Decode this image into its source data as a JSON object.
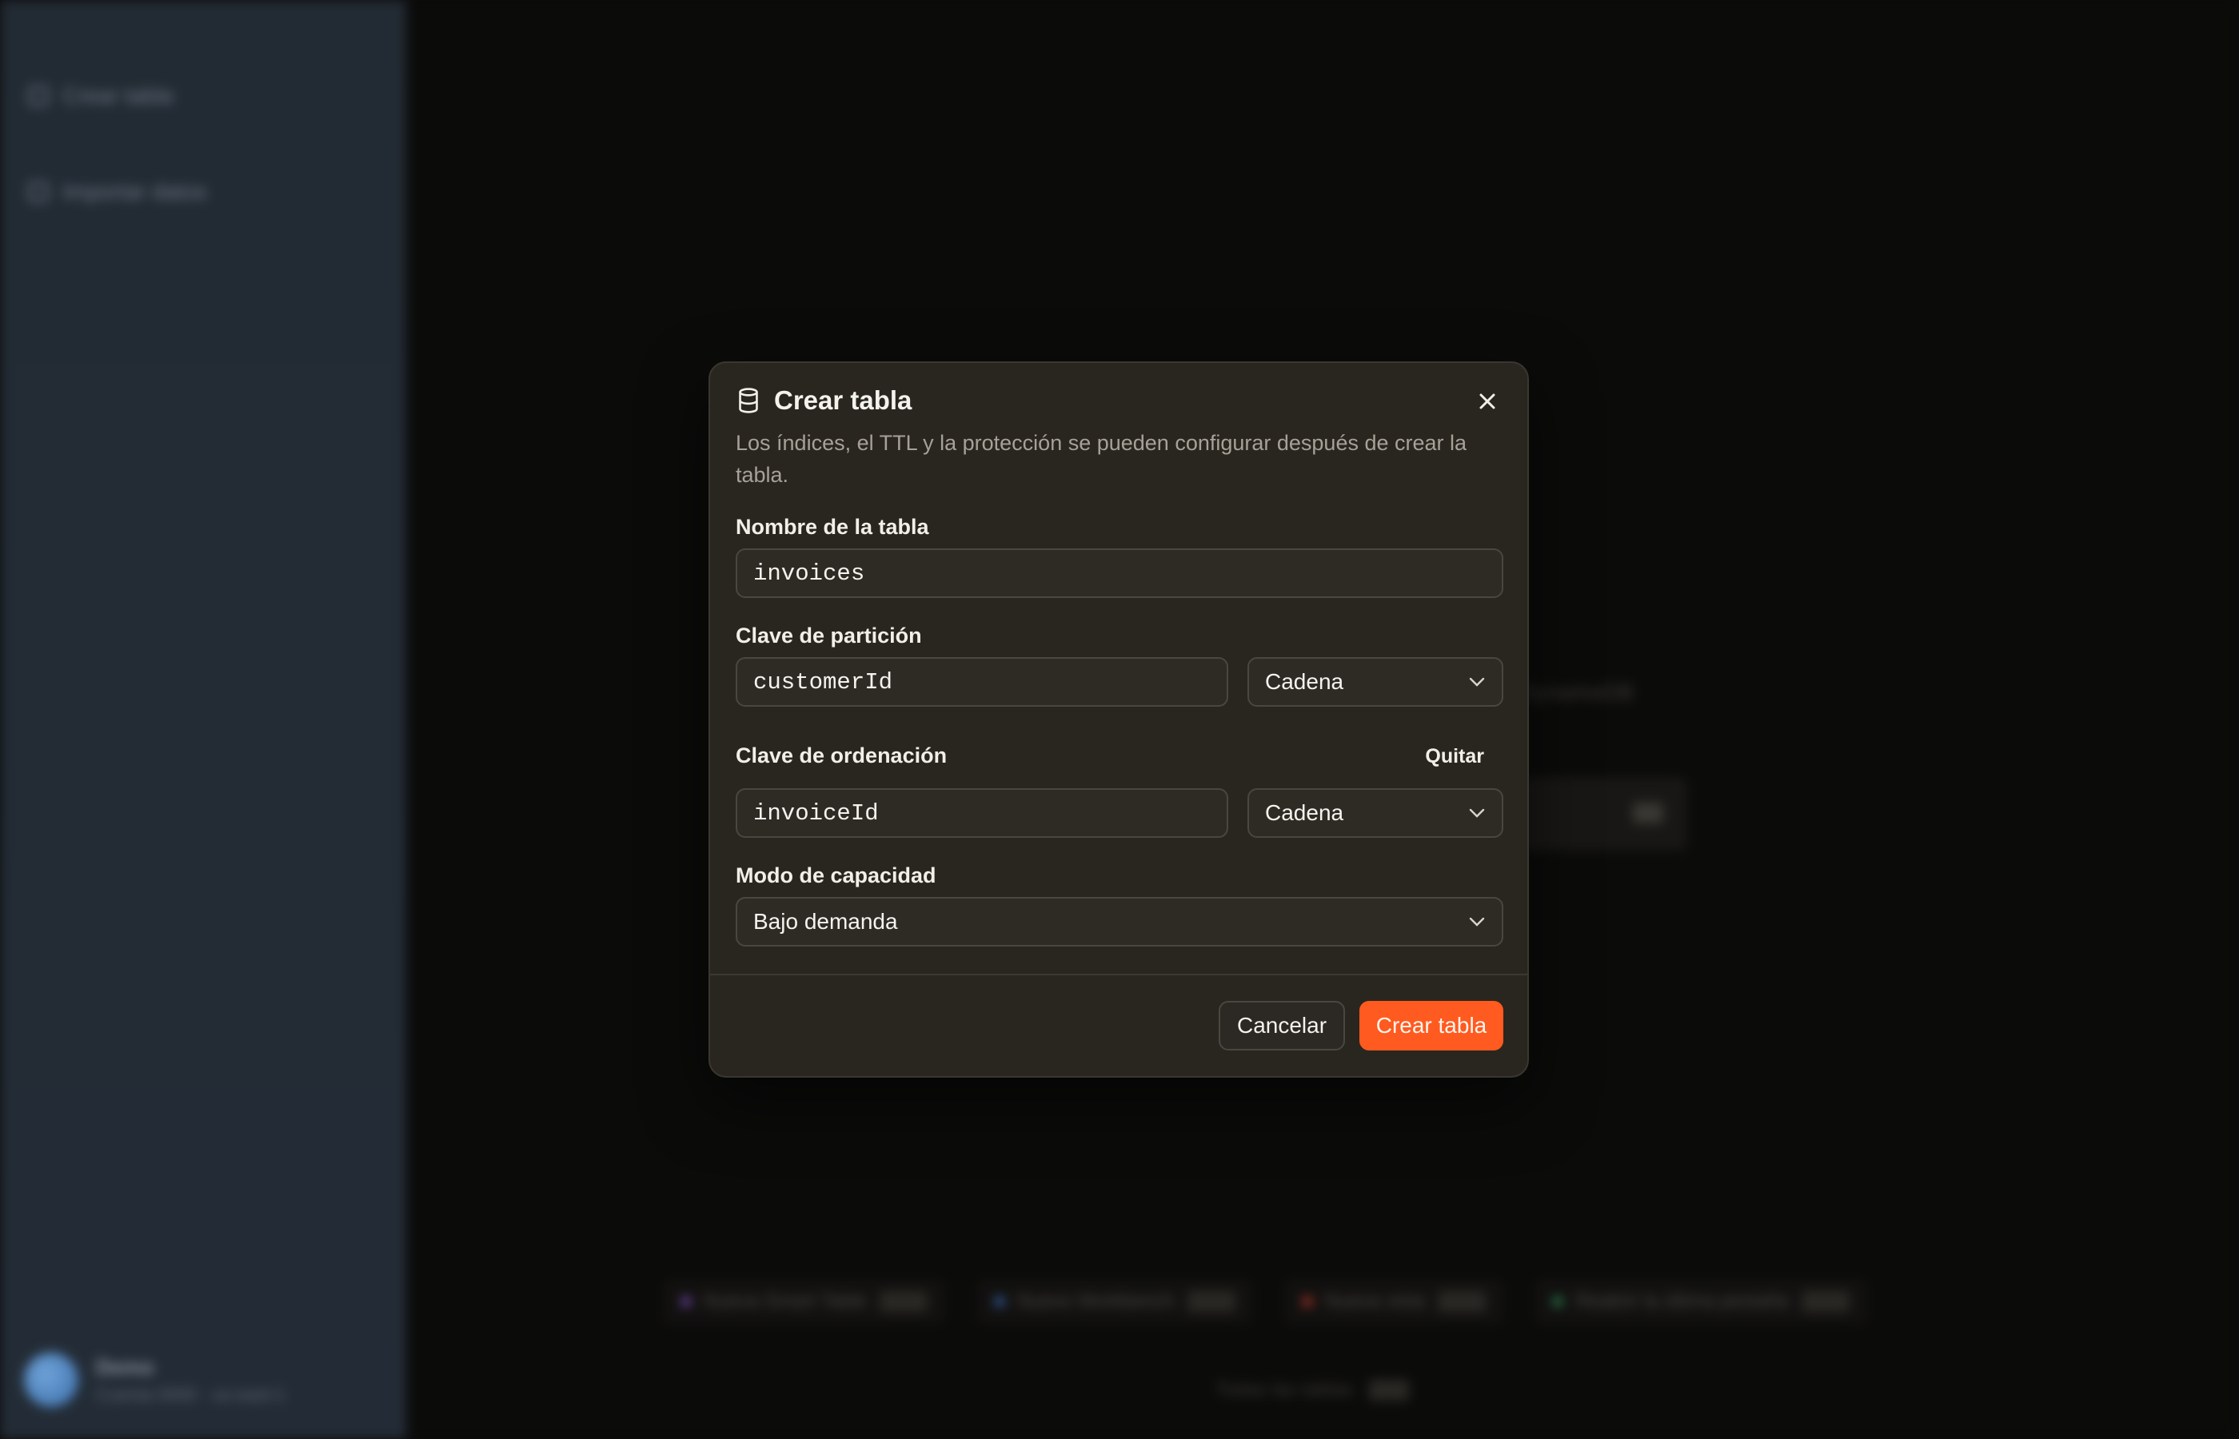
{
  "background": {
    "sidebar_items": [
      "Crear tabla",
      "Importar datos"
    ],
    "user": {
      "name": "Demo",
      "subtitle": "Cuenta 0000 · us-east-1"
    },
    "partial_text": "DynamoDB",
    "chips": [
      {
        "label": "Nueva Smart Table",
        "color": "#7c4dbb"
      },
      {
        "label": "Nuevo Workbench",
        "color": "#3b6db8"
      },
      {
        "label": "Nueva vista",
        "color": "#c0392b"
      },
      {
        "label": "Reabrir la última pestaña",
        "color": "#2e8b57"
      }
    ],
    "bottom_note": "Todas las tablas"
  },
  "modal": {
    "title": "Crear tabla",
    "icon": "database-icon",
    "description": "Los índices, el TTL y la protección se pueden configurar después de crear la tabla.",
    "table_name": {
      "label": "Nombre de la tabla",
      "value": "invoices"
    },
    "partition_key": {
      "label": "Clave de partición",
      "value": "customerId",
      "type": "Cadena"
    },
    "sort_key": {
      "label": "Clave de ordenación",
      "value": "invoiceId",
      "type": "Cadena",
      "remove_label": "Quitar"
    },
    "capacity": {
      "label": "Modo de capacidad",
      "value": "Bajo demanda"
    },
    "cancel_label": "Cancelar",
    "submit_label": "Crear tabla"
  },
  "colors": {
    "accent": "#ff5a1f",
    "modal_bg": "#292620"
  }
}
